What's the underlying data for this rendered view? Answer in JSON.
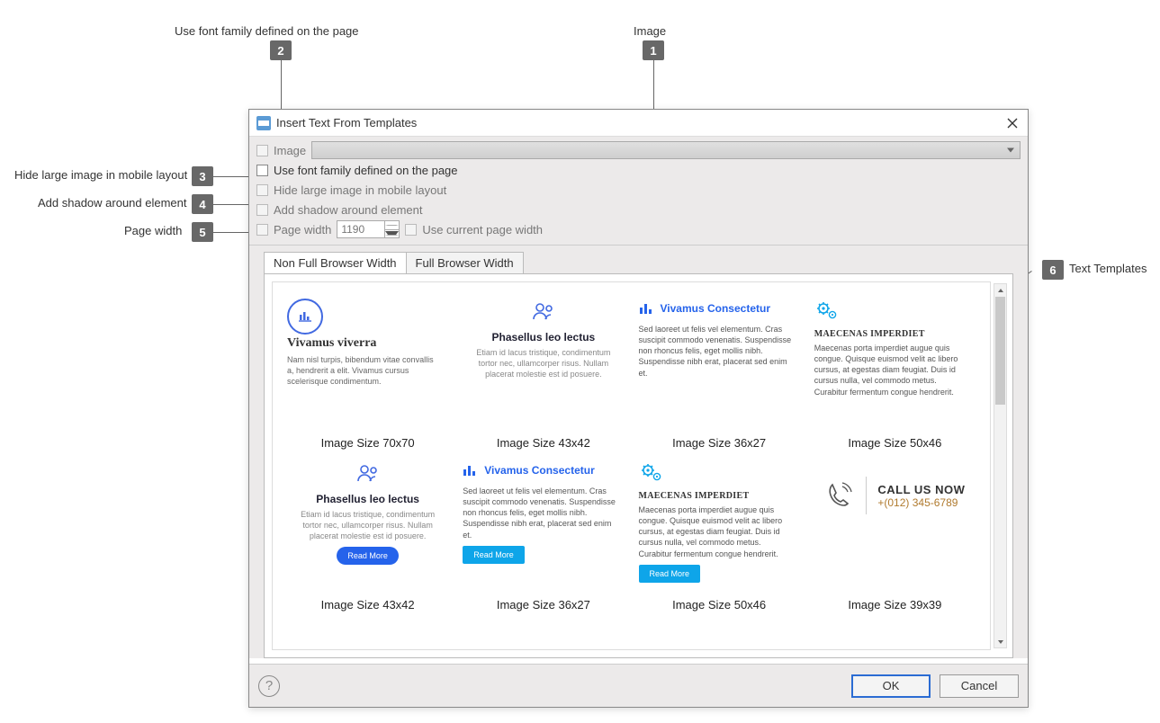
{
  "callouts": {
    "c1": {
      "num": "1",
      "label": "Image"
    },
    "c2": {
      "num": "2",
      "label": "Use font family defined on the page"
    },
    "c3": {
      "num": "3",
      "label": "Hide large image in mobile layout"
    },
    "c4": {
      "num": "4",
      "label": "Add shadow around element"
    },
    "c5": {
      "num": "5",
      "label": "Page width"
    },
    "c6": {
      "num": "6",
      "label": "Text Templates"
    }
  },
  "dialog": {
    "title": "Insert Text From Templates",
    "options": {
      "image_label": "Image",
      "use_font_label": "Use font family defined on the page",
      "hide_large_label": "Hide large image in mobile layout",
      "add_shadow_label": "Add shadow around element",
      "page_width_label": "Page width",
      "page_width_value": "1190",
      "use_current_label": "Use current page width"
    },
    "tabs": {
      "nonfull": "Non Full Browser Width",
      "full": "Full Browser Width"
    },
    "templates": {
      "row1": {
        "t1": {
          "title": "Vivamus viverra",
          "desc": "Nam nisl turpis, bibendum vitae convallis a, hendrerit a elit. Vivamus cursus scelerisque condimentum.",
          "label": "Image Size 70x70"
        },
        "t2": {
          "title": "Phasellus leo lectus",
          "desc": "Etiam id lacus tristique, condimentum tortor nec, ullamcorper risus. Nullam placerat molestie est id posuere.",
          "label": "Image Size 43x42"
        },
        "t3": {
          "title": "Vivamus Consectetur",
          "desc": "Sed laoreet ut felis vel elementum. Cras suscipit commodo venenatis. Suspendisse non rhoncus felis, eget mollis nibh. Suspendisse nibh erat, placerat sed enim et.",
          "label": "Image Size 36x27"
        },
        "t4": {
          "title": "MAECENAS IMPERDIET",
          "desc": "Maecenas porta imperdiet augue quis congue. Quisque euismod velit ac libero cursus, at egestas diam feugiat. Duis id cursus nulla, vel commodo metus. Curabitur fermentum congue hendrerit.",
          "label": "Image Size 50x46"
        }
      },
      "row2": {
        "t5": {
          "title": "Phasellus leo lectus",
          "desc": "Etiam id lacus tristique, condimentum tortor nec, ullamcorper risus. Nullam placerat molestie est id posuere.",
          "btn": "Read More",
          "label": "Image Size 43x42"
        },
        "t6": {
          "title": "Vivamus Consectetur",
          "desc": "Sed laoreet ut felis vel elementum. Cras suscipit commodo venenatis. Suspendisse non rhoncus felis, eget mollis nibh. Suspendisse nibh erat, placerat sed enim et.",
          "btn": "Read More",
          "label": "Image Size 36x27"
        },
        "t7": {
          "title": "MAECENAS IMPERDIET",
          "desc": "Maecenas porta imperdiet augue quis congue. Quisque euismod velit ac libero cursus, at egestas diam feugiat. Duis id cursus nulla, vel commodo metus. Curabitur fermentum congue hendrerit.",
          "btn": "Read More",
          "label": "Image Size 50x46"
        },
        "t8": {
          "line1": "CALL US NOW",
          "line2": "+(012) 345-6789",
          "label": "Image Size 39x39"
        }
      }
    },
    "buttons": {
      "ok": "OK",
      "cancel": "Cancel"
    }
  }
}
